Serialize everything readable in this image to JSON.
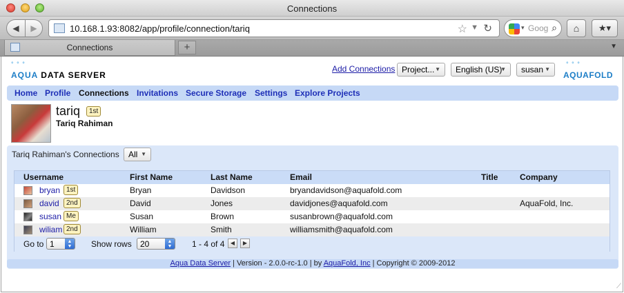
{
  "window": {
    "title": "Connections"
  },
  "browser": {
    "url": "10.168.1.93:8082/app/profile/connection/tariq",
    "search_placeholder": "Goog",
    "tab_title": "Connections",
    "new_tab": "+"
  },
  "header": {
    "logo_left": {
      "dots": "° ° °",
      "prefix": "AQUA",
      "suffix": " DATA SERVER"
    },
    "add_connections": "Add Connections",
    "project_select": "Project...",
    "language_select": "English (US)",
    "user_select": "susan",
    "logo_right": {
      "dots": "° ° °",
      "text": "AQUAFOLD"
    }
  },
  "nav": [
    "Home",
    "Profile",
    "Connections",
    "Invitations",
    "Secure Storage",
    "Settings",
    "Explore Projects"
  ],
  "profile": {
    "username": "tariq",
    "badge": "1st",
    "full_name": "Tariq Rahiman"
  },
  "connections": {
    "title": "Tariq Rahiman's Connections",
    "filter": "All",
    "columns": [
      "Username",
      "First Name",
      "Last Name",
      "Email",
      "Title",
      "Company"
    ],
    "rows": [
      {
        "username": "bryan",
        "badge": "1st",
        "first": "Bryan",
        "last": "Davidson",
        "email": "bryandavidson@aquafold.com",
        "title": "",
        "company": ""
      },
      {
        "username": "david",
        "badge": "2nd",
        "first": "David",
        "last": "Jones",
        "email": "davidjones@aquafold.com",
        "title": "",
        "company": "AquaFold, Inc."
      },
      {
        "username": "susan",
        "badge": "Me",
        "first": "Susan",
        "last": "Brown",
        "email": "susanbrown@aquafold.com",
        "title": "",
        "company": ""
      },
      {
        "username": "wiliam",
        "badge": "2nd",
        "first": "William",
        "last": "Smith",
        "email": "williamsmith@aquafold.com",
        "title": "",
        "company": ""
      }
    ],
    "pager": {
      "goto_label": "Go to",
      "goto_value": "1",
      "rows_label": "Show rows",
      "rows_value": "20",
      "range": "1 - 4 of 4"
    }
  },
  "footer": {
    "product_link": "Aqua Data Server",
    "version": " | Version - 2.0.0-rc-1.0 | by ",
    "company_link": "AquaFold, Inc",
    "copyright": " | Copyright © 2009-2012"
  },
  "colors": {
    "nav_bg": "#c6d9f6",
    "link": "#1e2fb7",
    "badge_bg": "#fdf3c0"
  }
}
